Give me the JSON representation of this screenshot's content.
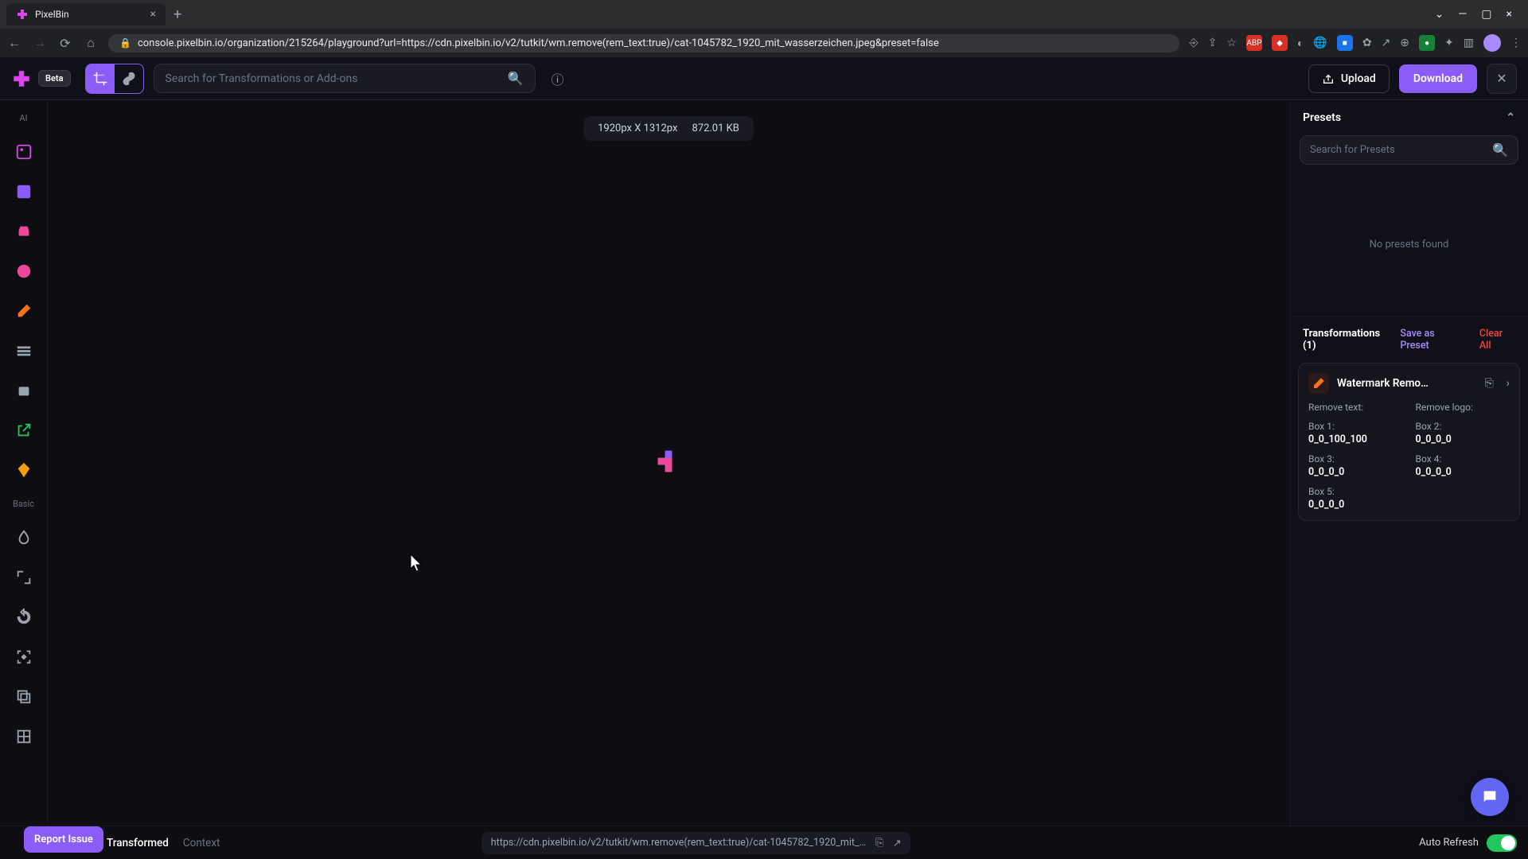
{
  "browser": {
    "tab_title": "PixelBin",
    "url": "console.pixelbin.io/organization/215264/playground?url=https://cdn.pixelbin.io/v2/tutkit/wm.remove(rem_text:true)/cat-1045782_1920_mit_wasserzeichen.jpeg&preset=false"
  },
  "topbar": {
    "beta_label": "Beta",
    "search_placeholder": "Search for Transformations or Add-ons",
    "upload_label": "Upload",
    "download_label": "Download"
  },
  "sidebar": {
    "ai_label": "AI",
    "basic_label": "Basic"
  },
  "canvas": {
    "dimensions": "1920px X 1312px",
    "filesize": "872.01 KB"
  },
  "presets": {
    "header": "Presets",
    "search_placeholder": "Search for Presets",
    "empty_text": "No presets found"
  },
  "transformations": {
    "header": "Transformations (1)",
    "save_label": "Save as Preset",
    "clear_label": "Clear All",
    "item": {
      "title": "Watermark Remo…",
      "fields": {
        "remove_text_label": "Remove text:",
        "remove_logo_label": "Remove logo:",
        "box1_label": "Box 1:",
        "box1_value": "0_0_100_100",
        "box2_label": "Box 2:",
        "box2_value": "0_0_0_0",
        "box3_label": "Box 3:",
        "box3_value": "0_0_0_0",
        "box4_label": "Box 4:",
        "box4_value": "0_0_0_0",
        "box5_label": "Box 5:",
        "box5_value": "0_0_0_0"
      }
    }
  },
  "bottom": {
    "report_label": "Report Issue",
    "tab_transformed": "Transformed",
    "tab_context": "Context",
    "url_preview": "https://cdn.pixelbin.io/v2/tutkit/wm.remove(rem_text:true)/cat-1045782_1920_mit_…",
    "auto_refresh_label": "Auto Refresh"
  }
}
